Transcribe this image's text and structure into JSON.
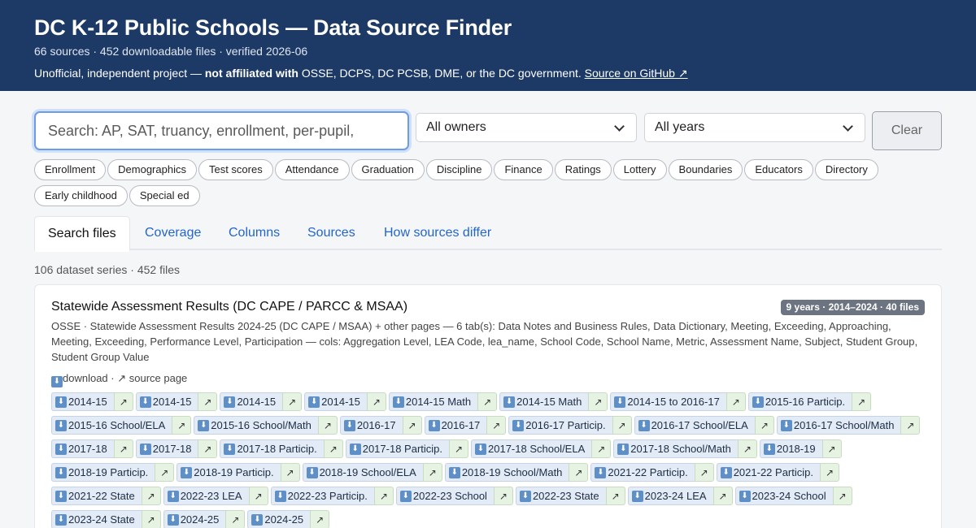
{
  "header": {
    "title": "DC K-12 Public Schools — Data Source Finder",
    "subtitle": "66 sources · 452 downloadable files · verified 2026-06",
    "disclaimer_pre": "Unofficial, independent project — ",
    "disclaimer_bold": "not affiliated with",
    "disclaimer_post": " OSSE, DCPS, DC PCSB, DME, or the DC government. ",
    "github_link": "Source on GitHub ↗"
  },
  "search": {
    "placeholder": "Search: AP, SAT, truancy, enrollment, per-pupil,"
  },
  "filters": {
    "owner": "All owners",
    "year": "All years",
    "clear_label": "Clear"
  },
  "topics": [
    "Enrollment",
    "Demographics",
    "Test scores",
    "Attendance",
    "Graduation",
    "Discipline",
    "Finance",
    "Ratings",
    "Lottery",
    "Boundaries",
    "Educators",
    "Directory",
    "Early childhood",
    "Special ed"
  ],
  "tabs": [
    "Search files",
    "Coverage",
    "Columns",
    "Sources",
    "How sources differ"
  ],
  "summary": "106 dataset series · 452 files",
  "card": {
    "title": "Statewide Assessment Results (DC CAPE / PARCC & MSAA)",
    "badge": "9 years · 2014–2024 · 40 files",
    "description": "OSSE · Statewide Assessment Results 2024-25 (DC CAPE / MSAA) + other pages — 6 tab(s): Data Notes and Business Rules, Data Dictionary, Meeting, Exceeding, Approaching, Meeting, Exceeding, Performance Level, Participation — cols: Aggregation Level, LEA Code, lea_name, School Code, School Name, Metric, Assessment Name, Subject, Student Group, Student Group Value",
    "download_label": "download",
    "source_label": "↗ source page",
    "files": [
      "2014-15",
      "2014-15",
      "2014-15",
      "2014-15",
      "2014-15 Math",
      "2014-15 Math",
      "2014-15 to 2016-17",
      "2015-16 Particip.",
      "2015-16 School/ELA",
      "2015-16 School/Math",
      "2016-17",
      "2016-17",
      "2016-17 Particip.",
      "2016-17 School/ELA",
      "2016-17 School/Math",
      "2017-18",
      "2017-18",
      "2017-18 Particip.",
      "2017-18 Particip.",
      "2017-18 School/ELA",
      "2017-18 School/Math",
      "2018-19",
      "2018-19 Particip.",
      "2018-19 Particip.",
      "2018-19 School/ELA",
      "2018-19 School/Math",
      "2021-22 Particip.",
      "2021-22 Particip.",
      "2021-22 State",
      "2022-23 LEA",
      "2022-23 Particip.",
      "2022-23 School",
      "2022-23 State",
      "2023-24 LEA",
      "2023-24 School",
      "2023-24 State",
      "2024-25",
      "2024-25"
    ]
  },
  "icons": {
    "download": "download-icon",
    "external": "external-link-icon"
  }
}
